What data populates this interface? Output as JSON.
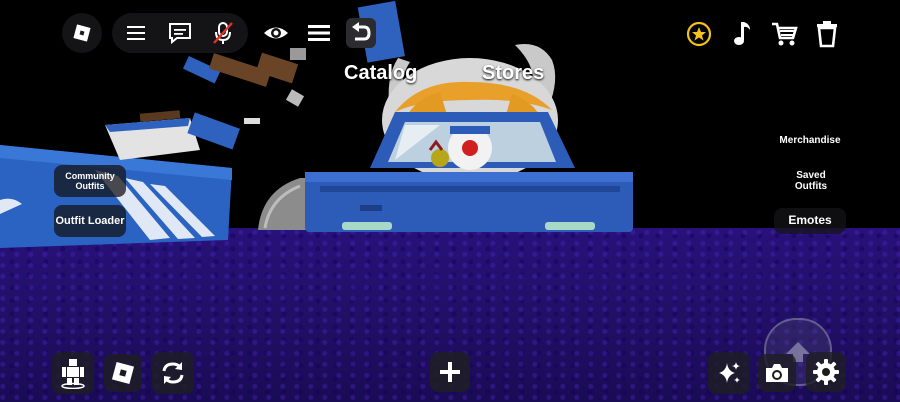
{
  "top_menu": {
    "catalog_label": "Catalog",
    "stores_label": "Stores"
  },
  "left_panel": {
    "community_outfits_label": "Community Outfits",
    "outfit_loader_label": "Outfit Loader"
  },
  "right_panel": {
    "merchandise_label": "Merchandise",
    "saved_outfits_label": "Saved Outfits",
    "emotes_label": "Emotes"
  },
  "topbar_icons": [
    "roblox-logo-icon",
    "hamburger-menu-icon",
    "chat-icon",
    "microphone-muted-icon",
    "eye-icon",
    "list-icon",
    "undo-icon",
    "star-icon",
    "music-note-icon",
    "shopping-cart-icon",
    "trash-icon"
  ],
  "bottom_icons": [
    "avatar-icon",
    "roblox-icon",
    "refresh-icon",
    "plus-icon",
    "sparkle-icon",
    "camera-icon",
    "settings-gear-icon",
    "jump-arrow-icon"
  ],
  "colors": {
    "floor": "#221068",
    "car_blue": "#2d5cb8",
    "star_gold": "#f3c21b",
    "mic_muted_red": "#e0322b"
  }
}
